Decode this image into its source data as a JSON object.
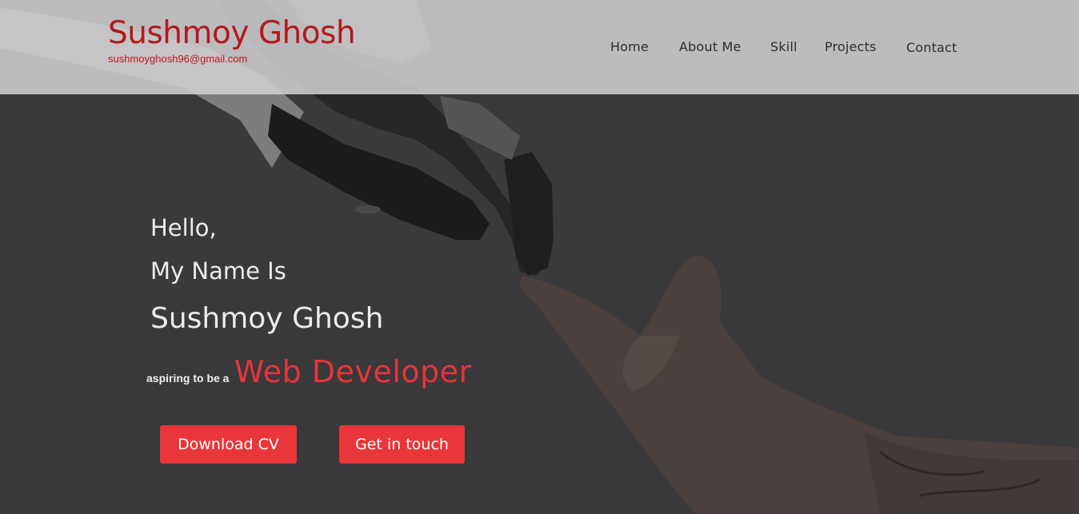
{
  "brand": {
    "name": "Sushmoy Ghosh",
    "email": "sushmoyghosh96@gmail.com"
  },
  "nav": {
    "items": [
      {
        "label": "Home"
      },
      {
        "label": "About Me"
      },
      {
        "label": "Skill"
      },
      {
        "label": "Projects"
      },
      {
        "label": "Contact"
      }
    ]
  },
  "hero": {
    "greeting_line1": "Hello,",
    "greeting_line2": "My Name Is",
    "name": "Sushmoy Ghosh",
    "tagline_prefix": "aspiring to be a",
    "tagline_role": "Web Developer",
    "buttons": {
      "download_cv": "Download CV",
      "get_in_touch": "Get in touch"
    }
  },
  "colors": {
    "accent": "#e8363a",
    "brand_red": "#b3191c",
    "overlay": "#3b3a3c"
  }
}
